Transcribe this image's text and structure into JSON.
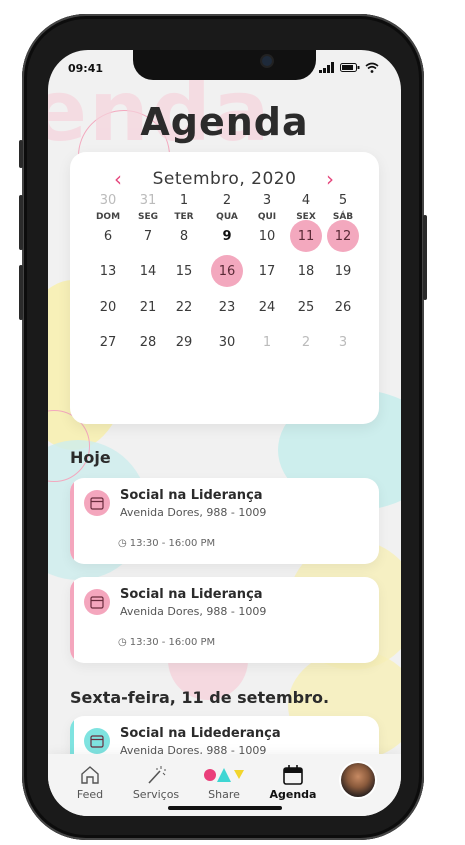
{
  "status": {
    "time": "09:41"
  },
  "background_word": "enda",
  "page": {
    "title": "Agenda"
  },
  "calendar": {
    "month_label": "Setembro, 2020",
    "weekdays": [
      "DOM",
      "SEG",
      "TER",
      "QUA",
      "QUI",
      "SEX",
      "SÁB"
    ],
    "weeks": [
      [
        "30",
        "31",
        "1",
        "2",
        "3",
        "4",
        "5"
      ],
      [
        "6",
        "7",
        "8",
        "9",
        "10",
        "11",
        "12"
      ],
      [
        "13",
        "14",
        "15",
        "16",
        "17",
        "18",
        "19"
      ],
      [
        "20",
        "21",
        "22",
        "23",
        "24",
        "25",
        "26"
      ],
      [
        "27",
        "28",
        "29",
        "30",
        "1",
        "2",
        "3"
      ]
    ],
    "muted_days": [
      "0-0",
      "0-1",
      "4-4",
      "4-5",
      "4-6"
    ],
    "today": "1-3",
    "selected_days": [
      "1-5",
      "1-6",
      "2-3"
    ],
    "accent_color": "#e5467c",
    "selected_color": "#f3a8be"
  },
  "sections": {
    "today": "Hoje",
    "next": "Sexta-feira, 11 de setembro."
  },
  "events": [
    {
      "title": "Social na Liderança",
      "address": "Avenida Dores, 988 - 1009",
      "time": "13:30 - 16:00 PM",
      "color": "#f4a6bd"
    },
    {
      "title": "Social na Liderança",
      "address": "Avenida Dores, 988 - 1009",
      "time": "13:30 - 16:00 PM",
      "color": "#f4a6bd"
    },
    {
      "title": "Social na Lidederança",
      "address": "Avenida Dores, 988 - 1009",
      "time": "",
      "color": "#7fe3e0"
    }
  ],
  "nav": {
    "feed": "Feed",
    "services": "Serviços",
    "share": "Share",
    "agenda": "Agenda",
    "active": "agenda"
  }
}
